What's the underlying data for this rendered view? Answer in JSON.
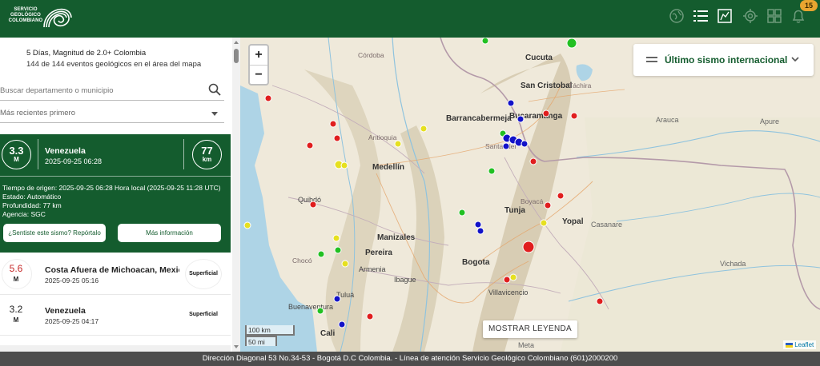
{
  "header": {
    "logo_lines": [
      "SERVICIO",
      "GEOLÓGICO",
      "COLOMBIANO"
    ],
    "notification_count": "15",
    "icons": [
      "globe-icon",
      "list-icon",
      "map-icon",
      "settings-icon",
      "grid-icon",
      "bell-icon"
    ]
  },
  "sidebar": {
    "summary_title": "5 Días, Magnitud de 2.0+ Colombia",
    "summary_subtitle": "144 de 144 eventos geológicos en el área del mapa",
    "search_placeholder": "Buscar departamento o municipio",
    "sort_label": "Más recientes primero",
    "active_event": {
      "magnitude": "3.3",
      "magnitude_unit": "M",
      "place": "Venezuela",
      "time": "2025-09-25 06:28",
      "depth": "77",
      "depth_unit": "km",
      "origin_time": "Tiempo de origen: 2025-09-25 06:28 Hora local (2025-09-25 11:28 UTC)",
      "status": "Estado: Automático",
      "depth_detail": "Profundidad: 77 km",
      "agency": "Agencia: SGC",
      "report_button": "¿Sentiste este sismo? Repórtalo",
      "info_button": "Más información"
    },
    "events": [
      {
        "magnitude": "5.6",
        "unit": "M",
        "place": "Costa Afuera de Michoacan, Mexico",
        "time": "2025-09-25 05:16",
        "depth": "Superficial",
        "color": "#c62828"
      },
      {
        "magnitude": "3.2",
        "unit": "M",
        "place": "Venezuela",
        "time": "2025-09-25 04:17",
        "depth": "Superficial",
        "color": "#222222"
      }
    ]
  },
  "map": {
    "zoom_in": "+",
    "zoom_out": "−",
    "intl_label": "Último sismo internacional",
    "legend_button": "MOSTRAR LEYENDA",
    "scale_km": "100 km",
    "scale_mi": "50 mi",
    "attribution": "Leaflet",
    "labels": {
      "cordoba": "Córdoba",
      "cucuta": "Cucuta",
      "san_cristobal": "San Cristobal",
      "tachira": "Táchira",
      "barrancabermeja": "Barrancabermeja",
      "bucaramanga": "Bucaramanga",
      "santander": "Santander",
      "arauca": "Arauca",
      "apure": "Apure",
      "antioquia": "Antioquia",
      "medellin": "Medellín",
      "boyaca": "Boyacá",
      "quibdo": "Quibdó",
      "choco": "Chocó",
      "tunja": "Tunja",
      "yopal": "Yopal",
      "casanare": "Casanare",
      "manizales": "Manizales",
      "pereira": "Pereira",
      "bogota": "Bogota",
      "armenia": "Armenia",
      "ibague": "Ibague",
      "vichada": "Vichada",
      "villavicencio": "Villavicencio",
      "tulua": "Tuluá",
      "buenaventura": "Buenaventura",
      "cali": "Cali",
      "meta": "Meta"
    },
    "colors": {
      "red": "#e01e1e",
      "green": "#22c022",
      "yellow": "#e6e020",
      "blue": "#1212c8"
    }
  },
  "footer": {
    "text": "Dirección Diagonal 53 No.34-53 - Bogotá D.C Colombia. - Línea de atención Servicio Geológico Colombiano (601)2000200"
  }
}
